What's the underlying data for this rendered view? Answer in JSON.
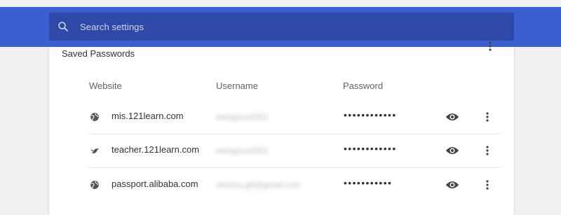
{
  "search": {
    "placeholder": "Search settings",
    "icon": "search-icon"
  },
  "section": {
    "title": "Saved Passwords"
  },
  "table": {
    "columns": [
      "Website",
      "Username",
      "Password"
    ],
    "rows": [
      {
        "site": "mis.121learn.com",
        "site_icon": "globe-icon",
        "username": "wangyou0001",
        "password": "••••••••••••"
      },
      {
        "site": "teacher.121learn.com",
        "site_icon": "bird-icon",
        "username": "wangyou0001",
        "password": "••••••••••••"
      },
      {
        "site": "passport.alibaba.com",
        "site_icon": "globe-icon",
        "username": "wlnnnu.gfl@gmail.com",
        "password": "•••••••••••"
      }
    ]
  },
  "colors": {
    "header_bg": "#3b5fd1",
    "search_bg": "#2e49a8",
    "page_bg": "#f1f1f1"
  }
}
